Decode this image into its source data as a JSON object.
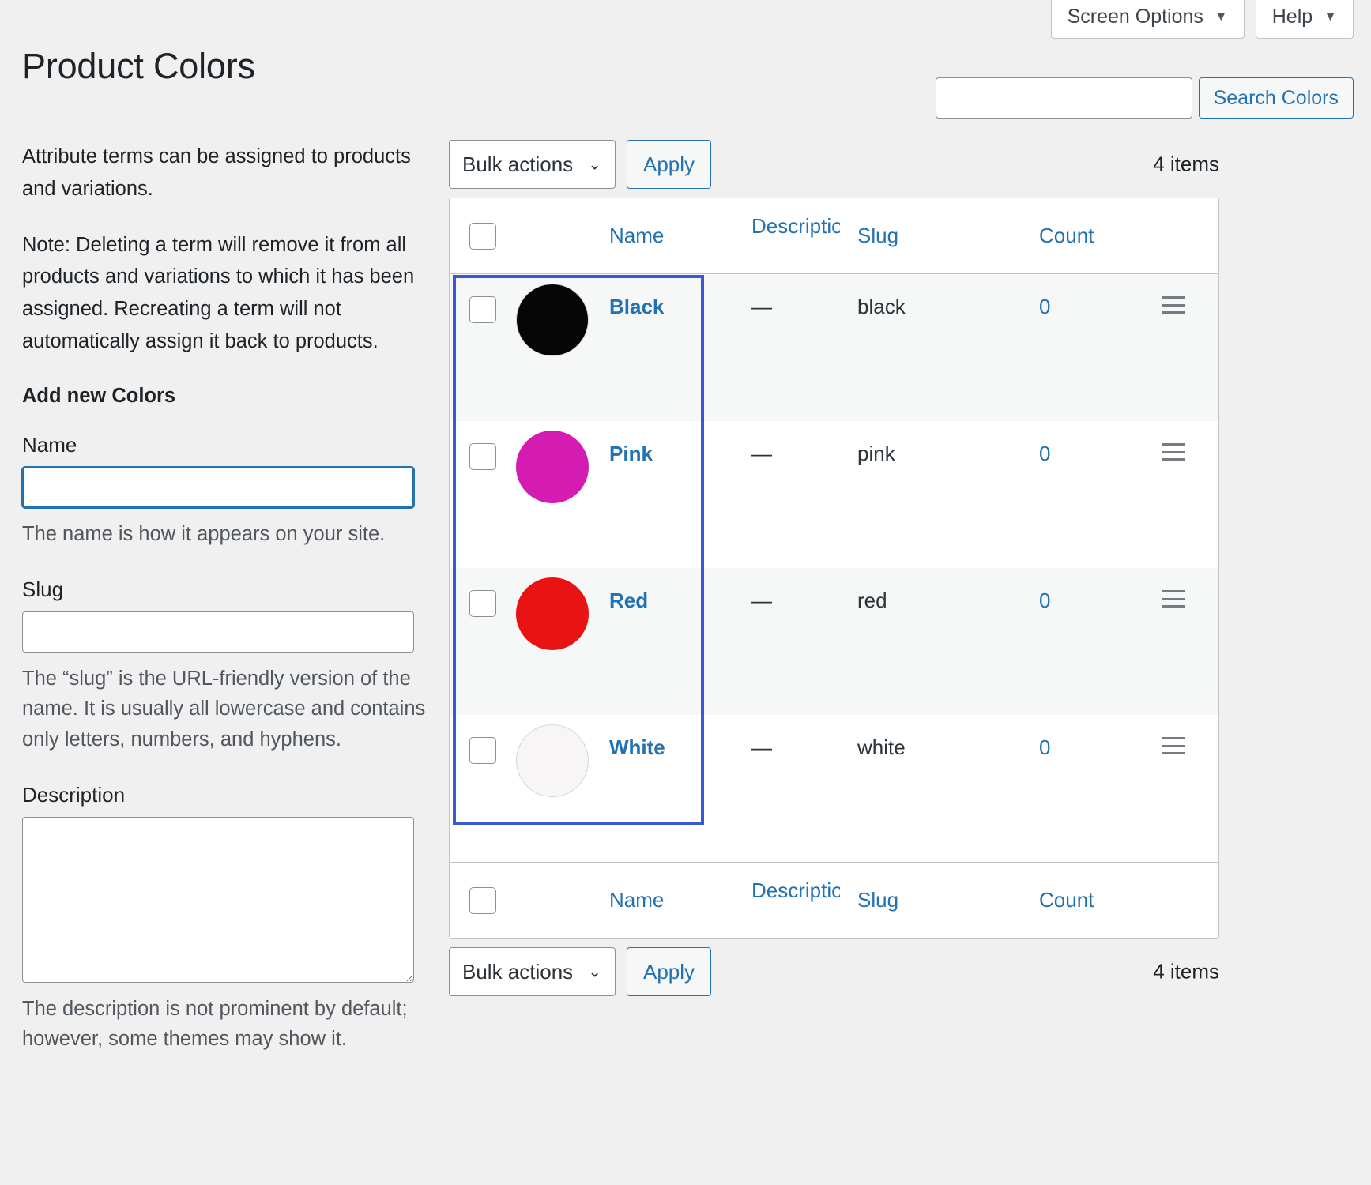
{
  "header": {
    "title": "Product Colors",
    "screen_options_label": "Screen Options",
    "help_label": "Help",
    "caret_glyph": "▼"
  },
  "search": {
    "value": "",
    "placeholder": "",
    "button_label": "Search Colors"
  },
  "sidebar": {
    "intro_1": "Attribute terms can be assigned to products and variations.",
    "intro_2": "Note: Deleting a term will remove it from all products and variations to which it has been assigned. Recreating a term will not automatically assign it back to products.",
    "add_new_heading": "Add new Colors",
    "name_label": "Name",
    "name_value": "",
    "name_help": "The name is how it appears on your site.",
    "slug_label": "Slug",
    "slug_value": "",
    "slug_help": "The “slug” is the URL-friendly version of the name. It is usually all lowercase and contains only letters, numbers, and hyphens.",
    "description_label": "Description",
    "description_value": "",
    "description_help": "The description is not prominent by default; however, some themes may show it."
  },
  "tablenav_top": {
    "bulk_actions_label": "Bulk actions",
    "apply_label": "Apply",
    "items_count": "4 items"
  },
  "tablenav_bottom": {
    "bulk_actions_label": "Bulk actions",
    "apply_label": "Apply",
    "items_count": "4 items"
  },
  "table": {
    "columns": {
      "name": "Name",
      "description": "Description",
      "slug": "Slug",
      "count": "Count"
    },
    "rows": [
      {
        "name": "Black",
        "swatch_color": "#050505",
        "swatch_border": "#d8d8d8",
        "description": "—",
        "slug": "black",
        "count": "0"
      },
      {
        "name": "Pink",
        "swatch_color": "#d41cb2",
        "swatch_border": "#d41cb2",
        "description": "—",
        "slug": "pink",
        "count": "0"
      },
      {
        "name": "Red",
        "swatch_color": "#ea1313",
        "swatch_border": "#ea1313",
        "description": "—",
        "slug": "red",
        "count": "0"
      },
      {
        "name": "White",
        "swatch_color": "#f7f5f6",
        "swatch_border": "#d5d5d5",
        "description": "—",
        "slug": "white",
        "count": "0"
      }
    ]
  },
  "colors": {
    "link": "#2271b1",
    "selection_outline": "#3858d6",
    "page_background": "#f0f0f1"
  }
}
